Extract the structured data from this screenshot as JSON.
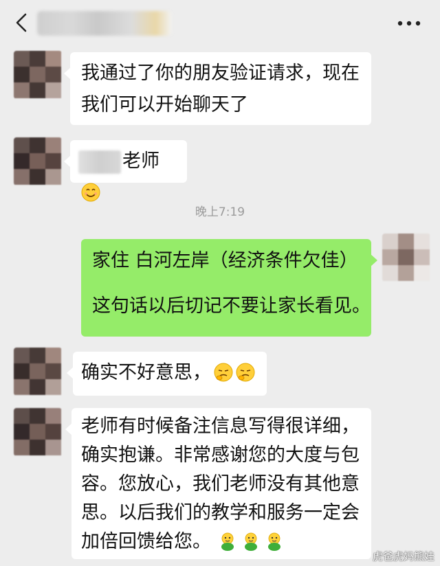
{
  "header": {
    "back_icon": "chevron-left-icon",
    "more_icon": "more-dots-icon"
  },
  "messages": [
    {
      "side": "left",
      "lines": [
        "我通过了你的朋友验证请求，现在",
        "我们可以开始聊天了"
      ]
    },
    {
      "side": "left",
      "text": "老师",
      "emoji": "smiling-face-icon"
    },
    {
      "side": "right",
      "lines": [
        "家住  白河左岸（经济条件欠佳）",
        "",
        "这句话以后切记不要让家长看见。"
      ]
    },
    {
      "side": "left",
      "text": "确实不好意思，",
      "emoji": "embarrassed-face-icon"
    },
    {
      "side": "left",
      "lines": [
        "老师有时候备注信息写得很详细，",
        "确实抱谦。非常感谢您的大度与包",
        "容。您放心，我们老师没有其他意",
        "思。以后我们的教学和服务一定会",
        "加倍回馈给您。"
      ],
      "emoji": "green-figure-icon"
    }
  ],
  "timestamp": "晚上7:19",
  "watermark": "虎爸虎妈熊娃",
  "colors": {
    "background": "#ededed",
    "sent_bubble": "#95ec69",
    "received_bubble": "#ffffff"
  }
}
